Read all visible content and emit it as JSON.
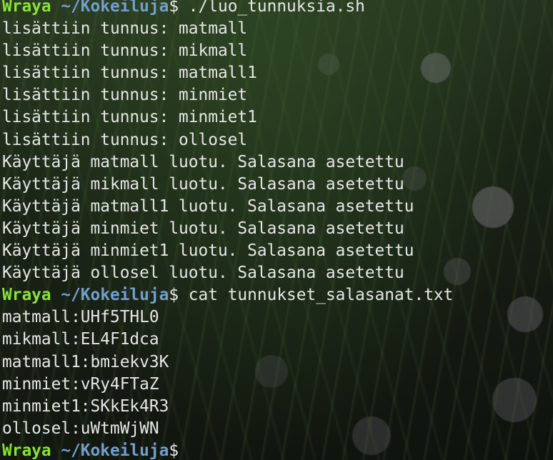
{
  "prompt": {
    "user": "Wraya",
    "path": "~/Kokeiluja",
    "symbol": "$"
  },
  "lines": [
    {
      "type": "prompt",
      "command": " ./luo_tunnuksia.sh"
    },
    {
      "type": "output",
      "text": "lisättiin tunnus: matmall"
    },
    {
      "type": "output",
      "text": "lisättiin tunnus: mikmall"
    },
    {
      "type": "output",
      "text": "lisättiin tunnus: matmall1"
    },
    {
      "type": "output",
      "text": "lisättiin tunnus: minmiet"
    },
    {
      "type": "output",
      "text": "lisättiin tunnus: minmiet1"
    },
    {
      "type": "output",
      "text": "lisättiin tunnus: ollosel"
    },
    {
      "type": "output",
      "text": "Käyttäjä matmall luotu. Salasana asetettu"
    },
    {
      "type": "output",
      "text": "Käyttäjä mikmall luotu. Salasana asetettu"
    },
    {
      "type": "output",
      "text": "Käyttäjä matmall1 luotu. Salasana asetettu"
    },
    {
      "type": "output",
      "text": "Käyttäjä minmiet luotu. Salasana asetettu"
    },
    {
      "type": "output",
      "text": "Käyttäjä minmiet1 luotu. Salasana asetettu"
    },
    {
      "type": "output",
      "text": "Käyttäjä ollosel luotu. Salasana asetettu"
    },
    {
      "type": "prompt",
      "command": " cat tunnukset_salasanat.txt"
    },
    {
      "type": "output",
      "text": "matmall:UHf5THL0"
    },
    {
      "type": "output",
      "text": "mikmall:EL4F1dca"
    },
    {
      "type": "output",
      "text": "matmall1:bmiekv3K"
    },
    {
      "type": "output",
      "text": "minmiet:vRy4FTaZ"
    },
    {
      "type": "output",
      "text": "minmiet1:SKkEk4R3"
    },
    {
      "type": "output",
      "text": "ollosel:uWtmWjWN"
    },
    {
      "type": "prompt",
      "command": ""
    }
  ],
  "colors": {
    "user": "#8ae234",
    "path": "#729fcf",
    "text": "#e6e6e6"
  }
}
